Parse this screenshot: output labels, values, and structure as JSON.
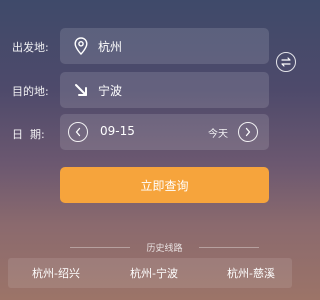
{
  "form": {
    "from_label": "出发地:",
    "from_value": "杭州",
    "to_label": "目的地:",
    "to_value": "宁波",
    "date_label": "日  期:",
    "date_value": "09-15",
    "date_today": "今天"
  },
  "actions": {
    "query_label": "立即查询"
  },
  "history": {
    "title": "历史线路",
    "items": [
      "杭州-绍兴",
      "杭州-宁波",
      "杭州-慈溪"
    ]
  },
  "colors": {
    "accent": "#f6a43c"
  }
}
